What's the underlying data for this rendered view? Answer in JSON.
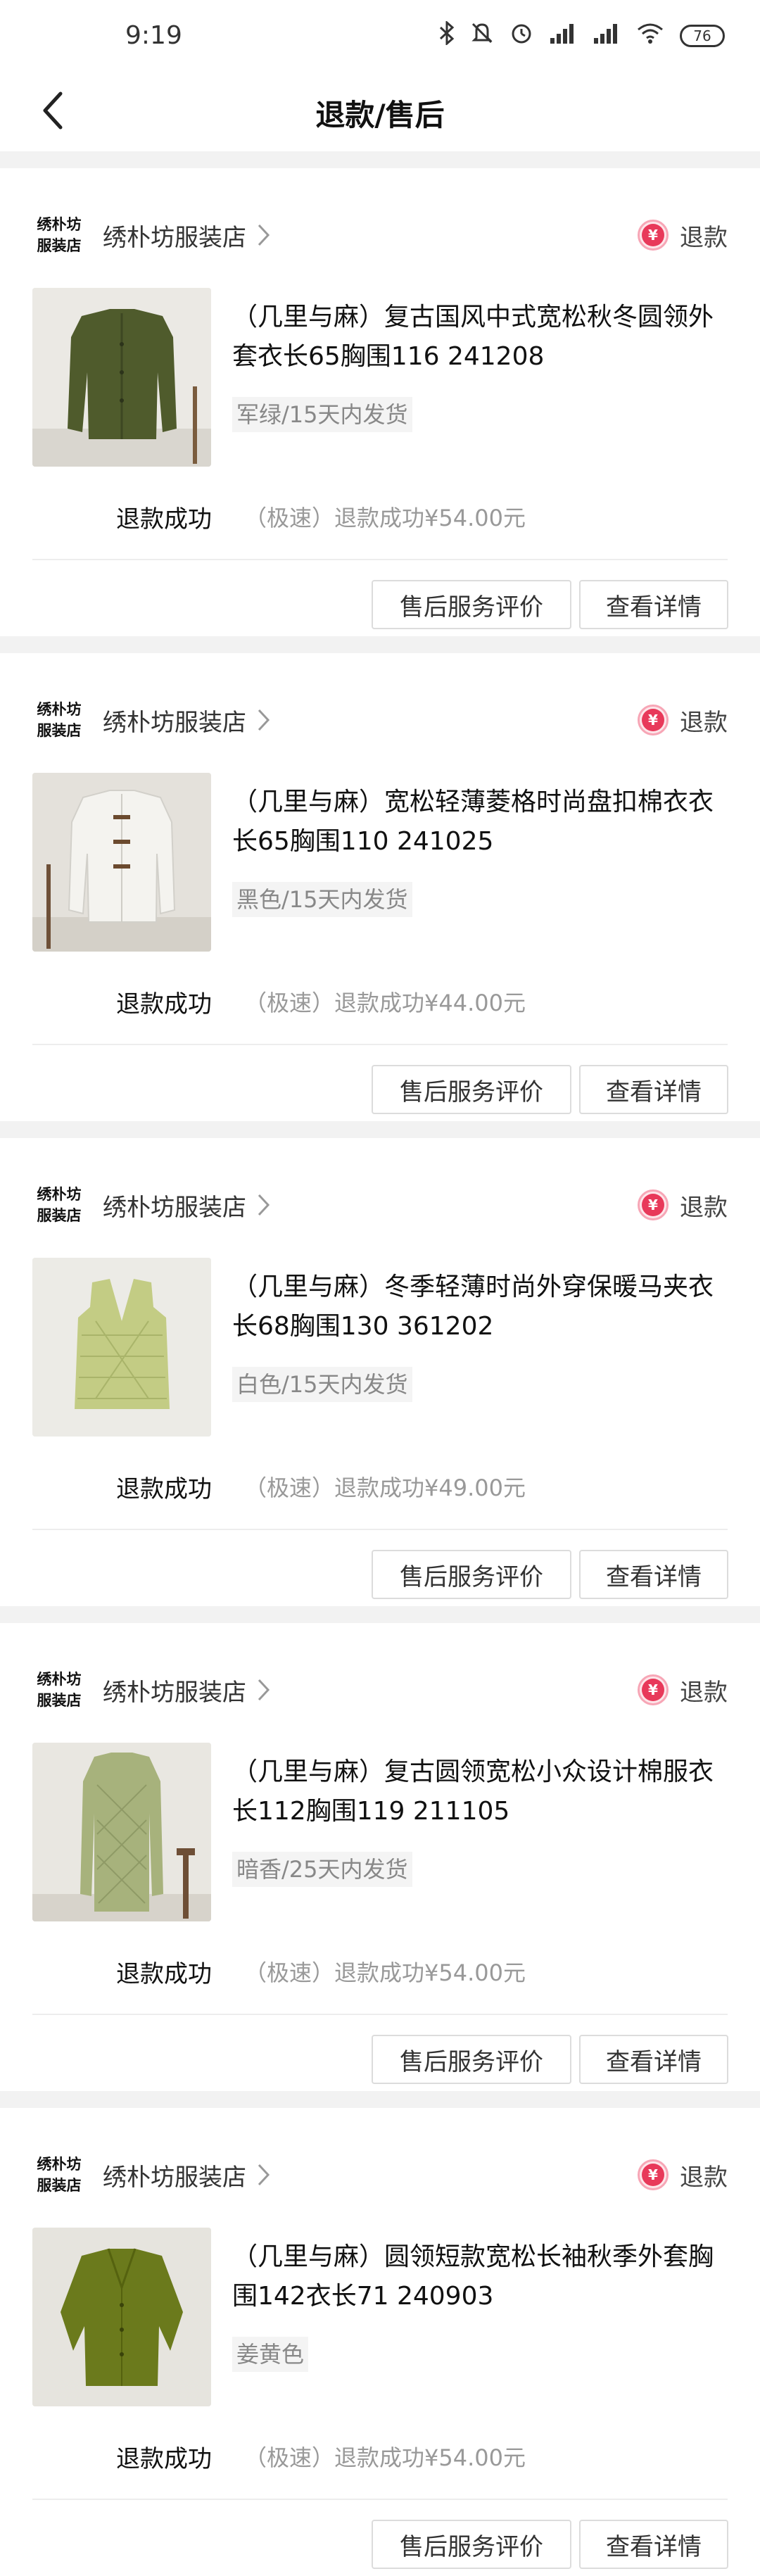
{
  "status_bar": {
    "time": "9:19",
    "battery": "76",
    "icons": [
      "bluetooth-icon",
      "mute-icon",
      "alarm-icon",
      "signal-icon",
      "signal-icon",
      "wifi-icon",
      "battery-icon"
    ]
  },
  "header": {
    "title": "退款/售后"
  },
  "colors": {
    "refund_accent": "#e8395a",
    "background": "#f2f2f2"
  },
  "orders": [
    {
      "shop_logo_line1": "绣朴坊",
      "shop_logo_line2": "服装店",
      "shop_name": "绣朴坊服装店",
      "refund_tag": "退款",
      "title": "（几里与麻）复古国风中式宽松秋冬圆领外套衣长65胸围116 241208",
      "spec": "军绿/15天内发货",
      "status": "退款成功",
      "status_detail": "（极速）退款成功¥54.00元",
      "review_button": "售后服务评价",
      "detail_button": "查看详情"
    },
    {
      "shop_logo_line1": "绣朴坊",
      "shop_logo_line2": "服装店",
      "shop_name": "绣朴坊服装店",
      "refund_tag": "退款",
      "title": "（几里与麻）宽松轻薄菱格时尚盘扣棉衣衣长65胸围110 241025",
      "spec": "黑色/15天内发货",
      "status": "退款成功",
      "status_detail": "（极速）退款成功¥44.00元",
      "review_button": "售后服务评价",
      "detail_button": "查看详情"
    },
    {
      "shop_logo_line1": "绣朴坊",
      "shop_logo_line2": "服装店",
      "shop_name": "绣朴坊服装店",
      "refund_tag": "退款",
      "title": "（几里与麻）冬季轻薄时尚外穿保暖马夹衣长68胸围130 361202",
      "spec": "白色/15天内发货",
      "status": "退款成功",
      "status_detail": "（极速）退款成功¥49.00元",
      "review_button": "售后服务评价",
      "detail_button": "查看详情"
    },
    {
      "shop_logo_line1": "绣朴坊",
      "shop_logo_line2": "服装店",
      "shop_name": "绣朴坊服装店",
      "refund_tag": "退款",
      "title": "（几里与麻）复古圆领宽松小众设计棉服衣长112胸围119 211105",
      "spec": "暗香/25天内发货",
      "status": "退款成功",
      "status_detail": "（极速）退款成功¥54.00元",
      "review_button": "售后服务评价",
      "detail_button": "查看详情"
    },
    {
      "shop_logo_line1": "绣朴坊",
      "shop_logo_line2": "服装店",
      "shop_name": "绣朴坊服装店",
      "refund_tag": "退款",
      "title": "（几里与麻）圆领短款宽松长袖秋季外套胸围142衣长71 240903",
      "spec": "姜黄色",
      "status": "退款成功",
      "status_detail": "（极速）退款成功¥54.00元",
      "review_button": "售后服务评价",
      "detail_button": "查看详情"
    }
  ]
}
